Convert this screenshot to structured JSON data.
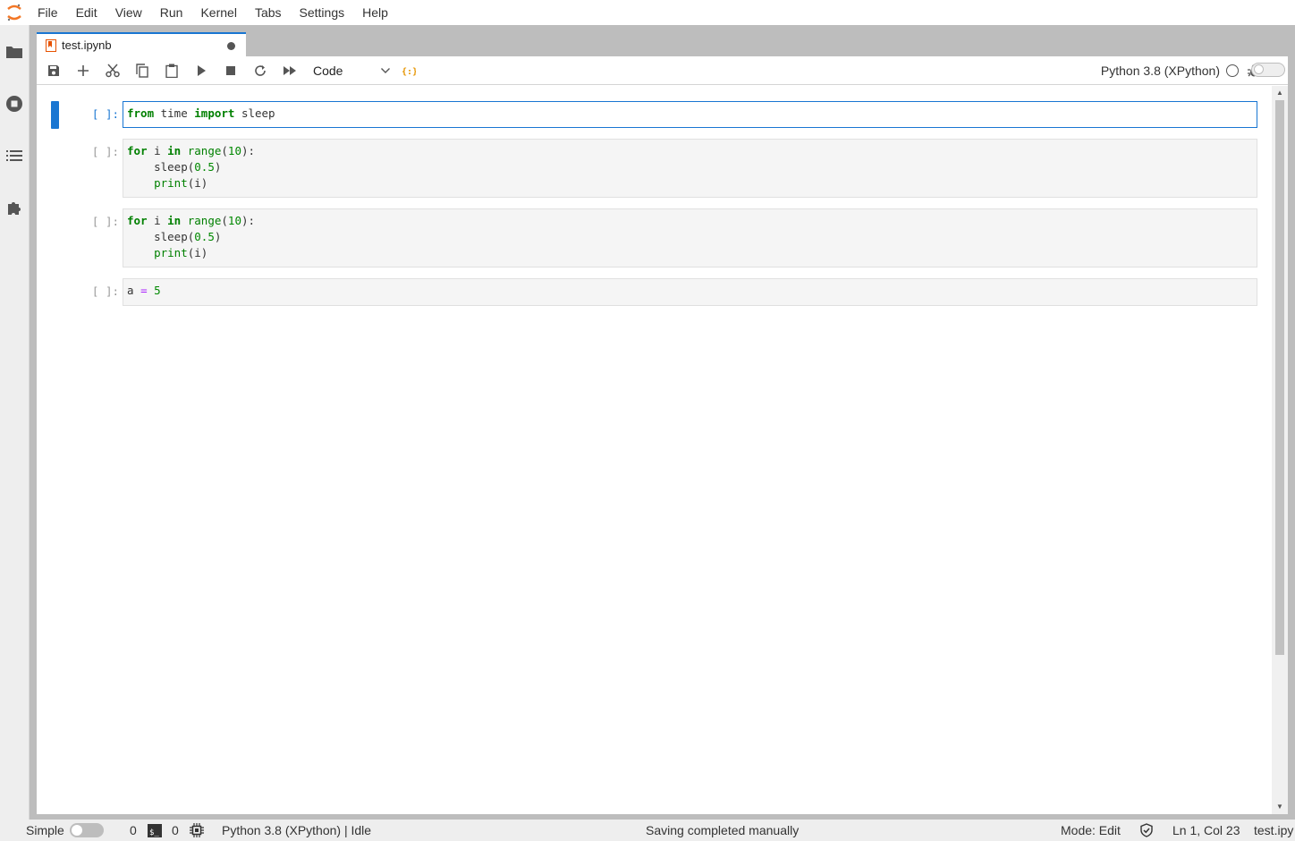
{
  "menubar": {
    "items": [
      "File",
      "Edit",
      "View",
      "Run",
      "Kernel",
      "Tabs",
      "Settings",
      "Help"
    ]
  },
  "tab": {
    "label": "test.ipynb"
  },
  "toolbar": {
    "cell_type": "Code",
    "kernel_name": "Python 3.8 (XPython)"
  },
  "cells": [
    {
      "prompt": "[ ]:"
    },
    {
      "prompt": "[ ]:"
    },
    {
      "prompt": "[ ]:"
    },
    {
      "prompt": "[ ]:"
    }
  ],
  "statusbar": {
    "simple_label": "Simple",
    "terminals_count": "0",
    "kernels_count": "0",
    "kernel_status": "Python 3.8 (XPython) | Idle",
    "message": "Saving completed manually",
    "mode": "Mode: Edit",
    "cursor": "Ln 1, Col 23",
    "filename": "test.ipy"
  },
  "colors": {
    "accent": "#1976d2",
    "keyword": "#008000",
    "kernel_icon": "#e65100"
  }
}
